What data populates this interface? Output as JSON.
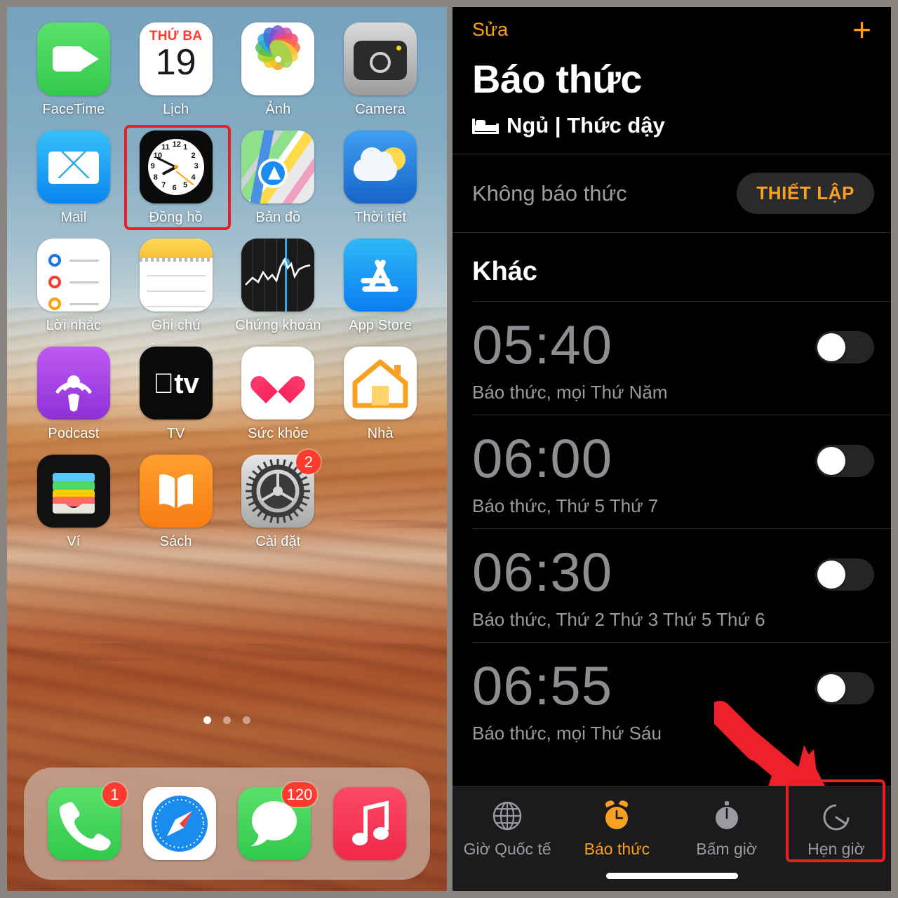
{
  "home_screen": {
    "rows": [
      [
        {
          "label": "FaceTime",
          "icon": "facetime-icon",
          "badge": null,
          "highlighted": false
        },
        {
          "label": "Lịch",
          "icon": "calendar-icon",
          "badge": null,
          "highlighted": false,
          "calendar_weekday": "THỨ BA",
          "calendar_day": "19"
        },
        {
          "label": "Ảnh",
          "icon": "photos-icon",
          "badge": null,
          "highlighted": false
        },
        {
          "label": "Camera",
          "icon": "camera-icon",
          "badge": null,
          "highlighted": false
        }
      ],
      [
        {
          "label": "Mail",
          "icon": "mail-icon",
          "badge": null,
          "highlighted": false
        },
        {
          "label": "Đồng hồ",
          "icon": "clock-icon",
          "badge": null,
          "highlighted": true
        },
        {
          "label": "Bản đồ",
          "icon": "maps-icon",
          "badge": null,
          "highlighted": false
        },
        {
          "label": "Thời tiết",
          "icon": "weather-icon",
          "badge": null,
          "highlighted": false
        }
      ],
      [
        {
          "label": "Lời nhắc",
          "icon": "reminders-icon",
          "badge": null,
          "highlighted": false
        },
        {
          "label": "Ghi chú",
          "icon": "notes-icon",
          "badge": null,
          "highlighted": false
        },
        {
          "label": "Chứng khoán",
          "icon": "stocks-icon",
          "badge": null,
          "highlighted": false
        },
        {
          "label": "App Store",
          "icon": "appstore-icon",
          "badge": null,
          "highlighted": false
        }
      ],
      [
        {
          "label": "Podcast",
          "icon": "podcasts-icon",
          "badge": null,
          "highlighted": false
        },
        {
          "label": "TV",
          "icon": "tv-icon",
          "badge": null,
          "highlighted": false
        },
        {
          "label": "Sức khỏe",
          "icon": "health-icon",
          "badge": null,
          "highlighted": false
        },
        {
          "label": "Nhà",
          "icon": "home-icon",
          "badge": null,
          "highlighted": false
        }
      ],
      [
        {
          "label": "Ví",
          "icon": "wallet-icon",
          "badge": null,
          "highlighted": false
        },
        {
          "label": "Sách",
          "icon": "books-icon",
          "badge": null,
          "highlighted": false
        },
        {
          "label": "Cài đặt",
          "icon": "settings-icon",
          "badge": "2",
          "highlighted": false
        },
        {
          "label": "",
          "icon": "",
          "badge": null,
          "highlighted": false,
          "empty": true
        }
      ]
    ],
    "page_dots": {
      "count": 3,
      "active_index": 0
    },
    "dock": [
      {
        "label": "Điện thoại",
        "icon": "phone-icon",
        "badge": "1"
      },
      {
        "label": "Safari",
        "icon": "safari-icon",
        "badge": null
      },
      {
        "label": "Tin nhắn",
        "icon": "messages-icon",
        "badge": "120"
      },
      {
        "label": "Nhạc",
        "icon": "music-icon",
        "badge": null
      }
    ]
  },
  "clock_app": {
    "nav": {
      "edit_label": "Sửa",
      "add_label": "+"
    },
    "title": "Báo thức",
    "sleep_section": {
      "header": "Ngủ | Thức dậy",
      "bed_icon": "bed-icon",
      "no_alarm_text": "Không báo thức",
      "setup_button": "THIẾT LẬP"
    },
    "other_section": {
      "header": "Khác",
      "alarms": [
        {
          "time": "05:40",
          "subtitle": "Báo thức, mọi Thứ Năm",
          "enabled": false
        },
        {
          "time": "06:00",
          "subtitle": "Báo thức, Thứ 5 Thứ 7",
          "enabled": false
        },
        {
          "time": "06:30",
          "subtitle": "Báo thức, Thứ 2 Thứ 3 Thứ 5 Thứ 6",
          "enabled": false
        },
        {
          "time": "06:55",
          "subtitle": "Báo thức, mọi Thứ Sáu",
          "enabled": false
        }
      ]
    },
    "tabs": [
      {
        "label": "Giờ Quốc tế",
        "icon": "globe-icon",
        "active": false,
        "highlighted": false
      },
      {
        "label": "Báo thức",
        "icon": "alarm-clock-icon",
        "active": true,
        "highlighted": false
      },
      {
        "label": "Bấm giờ",
        "icon": "stopwatch-icon",
        "active": false,
        "highlighted": false
      },
      {
        "label": "Hẹn giờ",
        "icon": "timer-icon",
        "active": false,
        "highlighted": true
      }
    ]
  },
  "annotations": {
    "highlight_color": "#ee1c25",
    "arrow_color": "#ee2029",
    "accent_color": "#ff9f0a"
  }
}
